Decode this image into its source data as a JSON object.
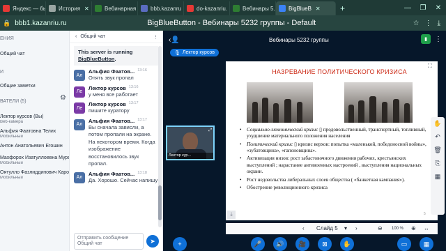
{
  "browser": {
    "tabs": [
      {
        "label": "Яндекс — бь",
        "color": "#e53935"
      },
      {
        "label": "История",
        "color": "#9aa6a3"
      },
      {
        "label": "Вебинарная",
        "color": "#2e7d32"
      },
      {
        "label": "bbb.kazanru",
        "color": "#5a6cc0"
      },
      {
        "label": "do-kazanriu.",
        "color": "#e53935"
      },
      {
        "label": "Вебинары 5.",
        "color": "#2e7d32"
      },
      {
        "label": "BigBlueB",
        "color": "#3b82f6"
      }
    ],
    "url": "bbb1.kazanriu.ru",
    "page_title": "BigBlueButton - Вебинары 5232 группы - Default"
  },
  "left_panel": {
    "messages_header": "ЕНИЯ",
    "public_chat": "Общий чат",
    "notes_header": "И",
    "shared_notes": "Общие заметки",
    "users_header": "ВАТЕЛИ (5)",
    "users": [
      {
        "name": "Лектор курсов (Вы)",
        "sub": "Веб-камера"
      },
      {
        "name": "Альфия Фаатовна Телих",
        "sub": "Мобильный"
      },
      {
        "name": "Антон Анатольевич Егошин",
        "sub": ""
      },
      {
        "name": "Махфорох Изатуллоевна Муро...",
        "sub": "Мобильный"
      },
      {
        "name": "Оятулло Фазлиддинович Кароми...",
        "sub": "Мобильный"
      }
    ]
  },
  "chat": {
    "header": "Общий чат",
    "system_message_line1": "This server is running",
    "system_message_link": "BigBlueButton",
    "messages": [
      {
        "initials": "Ал",
        "name": "Альфия Фаатов...",
        "time": "13:16",
        "text": "Опять звук пропал"
      },
      {
        "initials": "Ле",
        "name": "Лектор курсов",
        "time": "13:16",
        "text": "у меня все работает"
      },
      {
        "initials": "Ле",
        "name": "Лектор курсов",
        "time": "13:17",
        "text": "пишите куратору"
      },
      {
        "initials": "Ал",
        "name": "Альфия Фаатов...",
        "time": "13:17",
        "text": "Вы сначала зависли, а потом пропали на экране. На некотором время. Когда изображение восстановилось звук пропал."
      },
      {
        "initials": "Ал",
        "name": "Альфия Фаатов...",
        "time": "13:18",
        "text": "Да. Хорошо. Сейчас напишу"
      }
    ],
    "input_placeholder": "Отправить сообщение Общий чат"
  },
  "main": {
    "title": "Вебинары 5232 группы",
    "speaker_label": "Лектор курсов",
    "webcam_caption": "Лектор кур...",
    "slide": {
      "title": "НАЗРЕВАНИЕ ПОЛИТИЧЕСКОГО КРИЗИСА",
      "bullets": [
        {
          "italic": "Социально-экономический кризис",
          "text": " продовольственный, транспортный, топливный, ухудшение материального положения населения"
        },
        {
          "italic": "Политический кризис",
          "text": " кризис верхов: попытка «маленькой, победоносной войны», «зубатовщина», «гапоновщина»."
        },
        {
          "italic": "",
          "text": "Активизация низов: рост забастовочного движения рабочих, крестьянских выступлений ; нарастание антивоенных настроений , выступления национальных окраин."
        },
        {
          "italic": "",
          "text": "Рост недовольства либеральных слоев общества ( «банкетная кампания»)."
        },
        {
          "italic": "",
          "text": "Обострение революционного кризиса"
        }
      ],
      "page_marker": "5"
    },
    "slide_nav": {
      "label": "Слайд 5",
      "zoom": "100 %"
    }
  },
  "colors": {
    "accent": "#0f70d7",
    "main_bg": "#06172a",
    "slide_title": "#cc2a16",
    "connection": "#1e9e4a"
  }
}
